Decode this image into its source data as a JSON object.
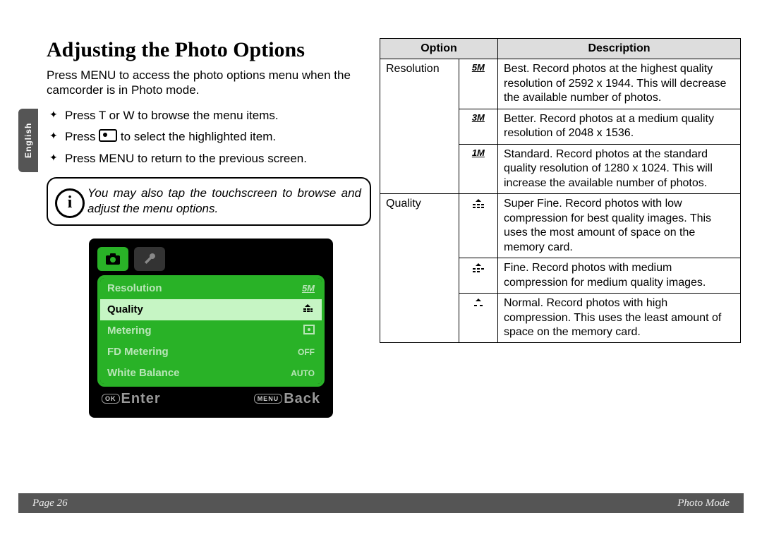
{
  "lang_tab": "English",
  "heading": "Adjusting the Photo Options",
  "intro": "Press MENU to access the photo options menu when the camcorder is in Photo mode.",
  "bullets": {
    "b1": "Press T or W to browse the menu items.",
    "b2a": "Press ",
    "b2b": " to select the highlighted item.",
    "b3": "Press MENU to return to the previous screen."
  },
  "info_note": "You may also tap the touchscreen to browse and adjust the menu options.",
  "shot": {
    "rows": [
      {
        "label": "Resolution",
        "val": "5M"
      },
      {
        "label": "Quality",
        "val": ""
      },
      {
        "label": "Metering",
        "val": ""
      },
      {
        "label": "FD Metering",
        "val": "OFF"
      },
      {
        "label": "White Balance",
        "val": "AUTO"
      }
    ],
    "ok": "OK",
    "enter": "Enter",
    "menu": "MENU",
    "back": "Back"
  },
  "table": {
    "h1": "Option",
    "h2": "Description",
    "resolution_label": "Resolution",
    "quality_label": "Quality",
    "rows": {
      "r5m_icon": "5M",
      "r5m": "Best. Record photos at the highest quality resolution of 2592 x 1944. This will decrease the available number of photos.",
      "r3m_icon": "3M",
      "r3m": "Better. Record photos at a medium quality resolution of 2048 x 1536.",
      "r1m_icon": "1M",
      "r1m": "Standard. Record photos at the standard quality resolution of 1280 x 1024. This will increase the available number of photos.",
      "qsf": "Super Fine. Record photos with low compression for best quality images. This uses the most amount of space on the memory card.",
      "qf": "Fine. Record photos with medium compression for medium quality images.",
      "qn": "Normal. Record photos with high compression. This uses the least amount of space on the memory card."
    }
  },
  "footer": {
    "left": "Page 26",
    "right": "Photo Mode"
  }
}
